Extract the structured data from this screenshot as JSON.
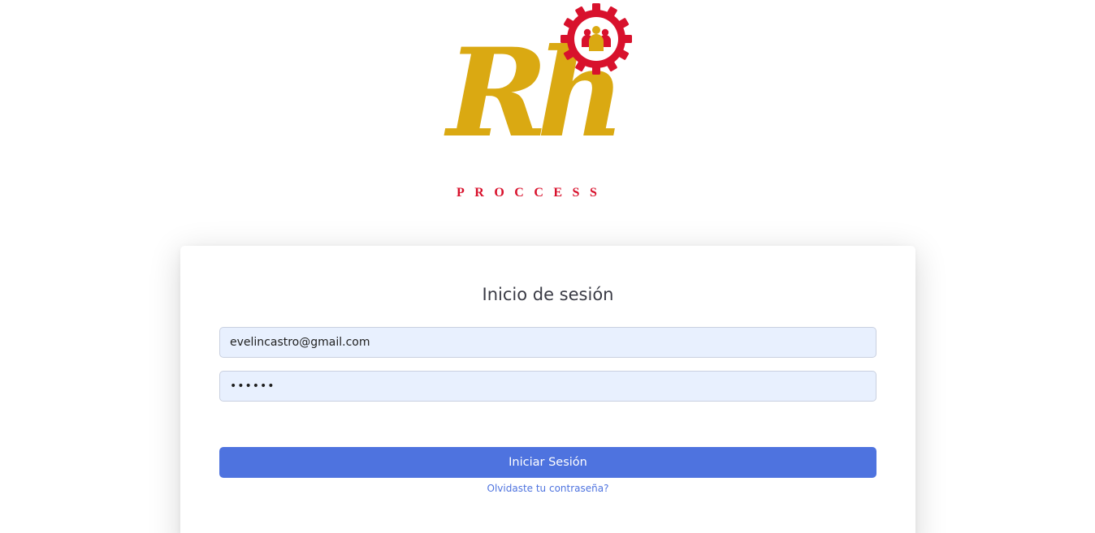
{
  "logo": {
    "brand_letters": "Rh",
    "brand_text": "PROCCESS",
    "gear_icon": "gear-people-icon",
    "colors": {
      "gold": "#daa912",
      "red": "#d8112c"
    }
  },
  "login": {
    "title": "Inicio de sesión",
    "email_value": "evelincastro@gmail.com",
    "password_value": "••••••",
    "submit_label": "Iniciar Sesión",
    "forgot_label": "Olvidaste tu contraseña?"
  },
  "colors": {
    "primary": "#4e73df",
    "input_bg": "#e8f0fe"
  }
}
